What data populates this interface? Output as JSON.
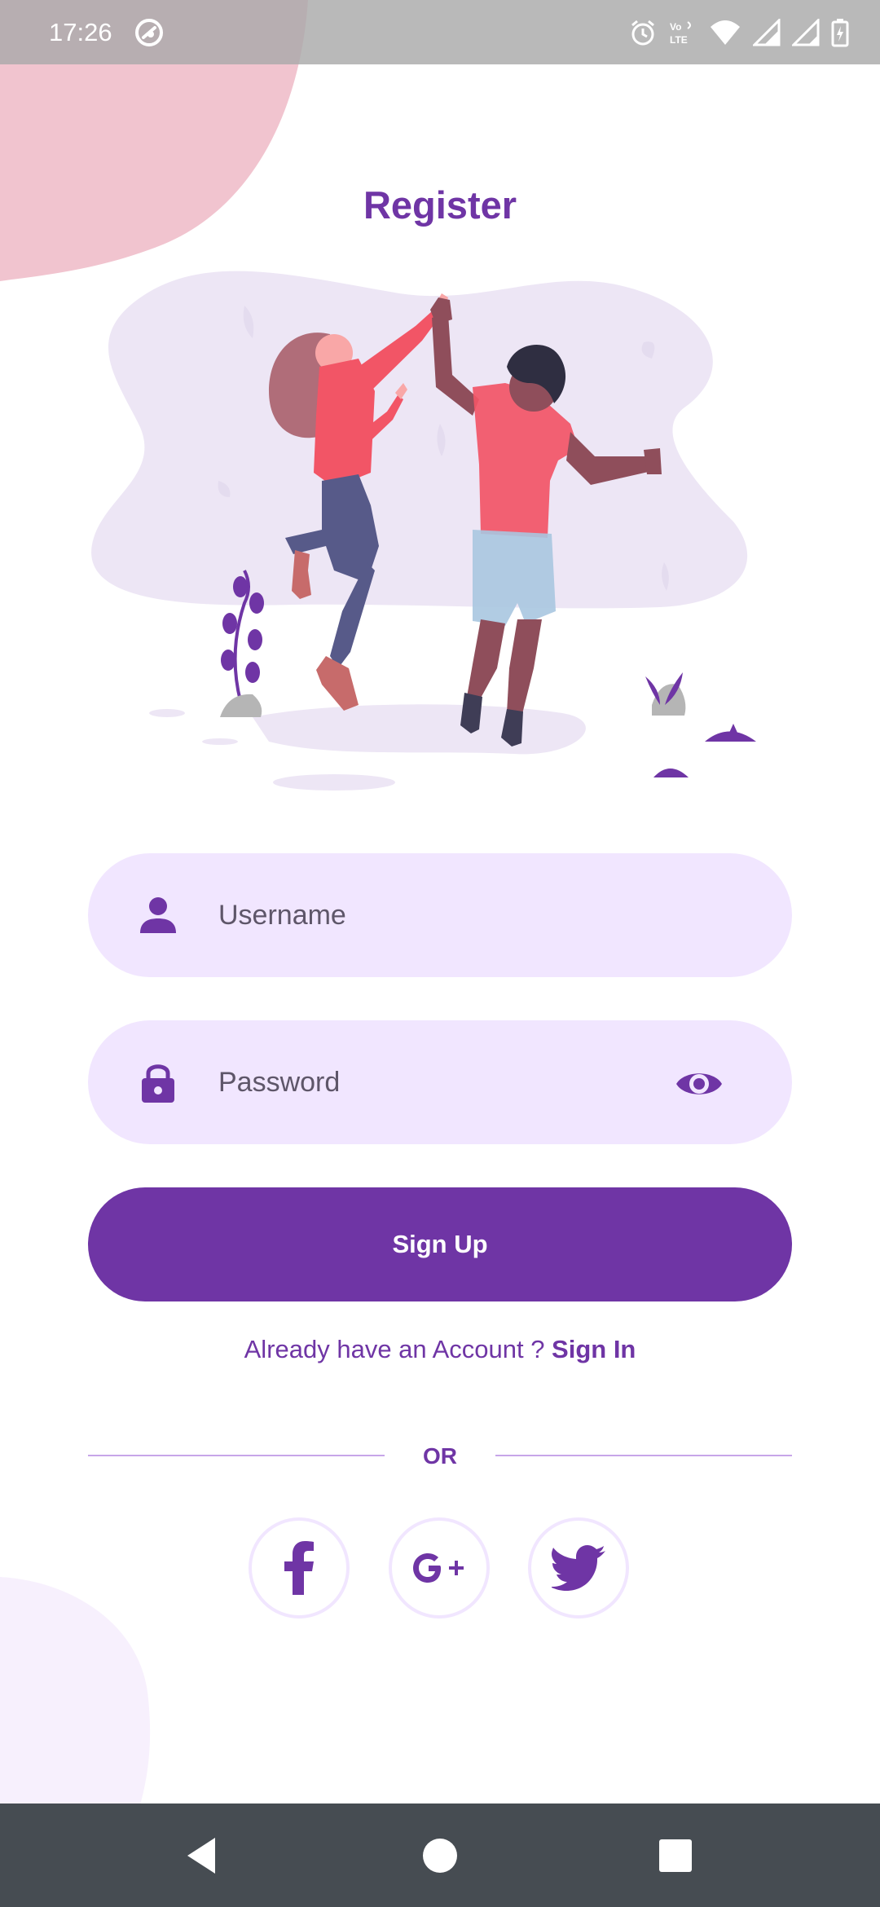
{
  "status_bar": {
    "time": "17:26",
    "icons": [
      "app-notification-icon",
      "alarm-icon",
      "volte-icon",
      "wifi-icon",
      "signal-icon",
      "signal-icon",
      "battery-charging-icon"
    ]
  },
  "page": {
    "title": "Register"
  },
  "form": {
    "username": {
      "placeholder": "Username",
      "value": "",
      "icon": "person-icon"
    },
    "password": {
      "placeholder": "Password",
      "value": "",
      "icon": "lock-icon",
      "toggle_icon": "eye-icon"
    },
    "signup_label": "Sign Up"
  },
  "account": {
    "prompt": "Already have an Account ? ",
    "signin_label": "Sign In"
  },
  "divider": {
    "label": "OR"
  },
  "social": [
    {
      "name": "facebook-icon"
    },
    {
      "name": "google-plus-icon"
    },
    {
      "name": "twitter-icon"
    }
  ],
  "nav_bar": {
    "buttons": [
      "back-icon",
      "home-icon",
      "recents-icon"
    ]
  },
  "colors": {
    "primary": "#6f35a5",
    "field_background": "#f1e6ff",
    "top_blob": "#f1c4cf",
    "nav_bar": "#464c52"
  }
}
